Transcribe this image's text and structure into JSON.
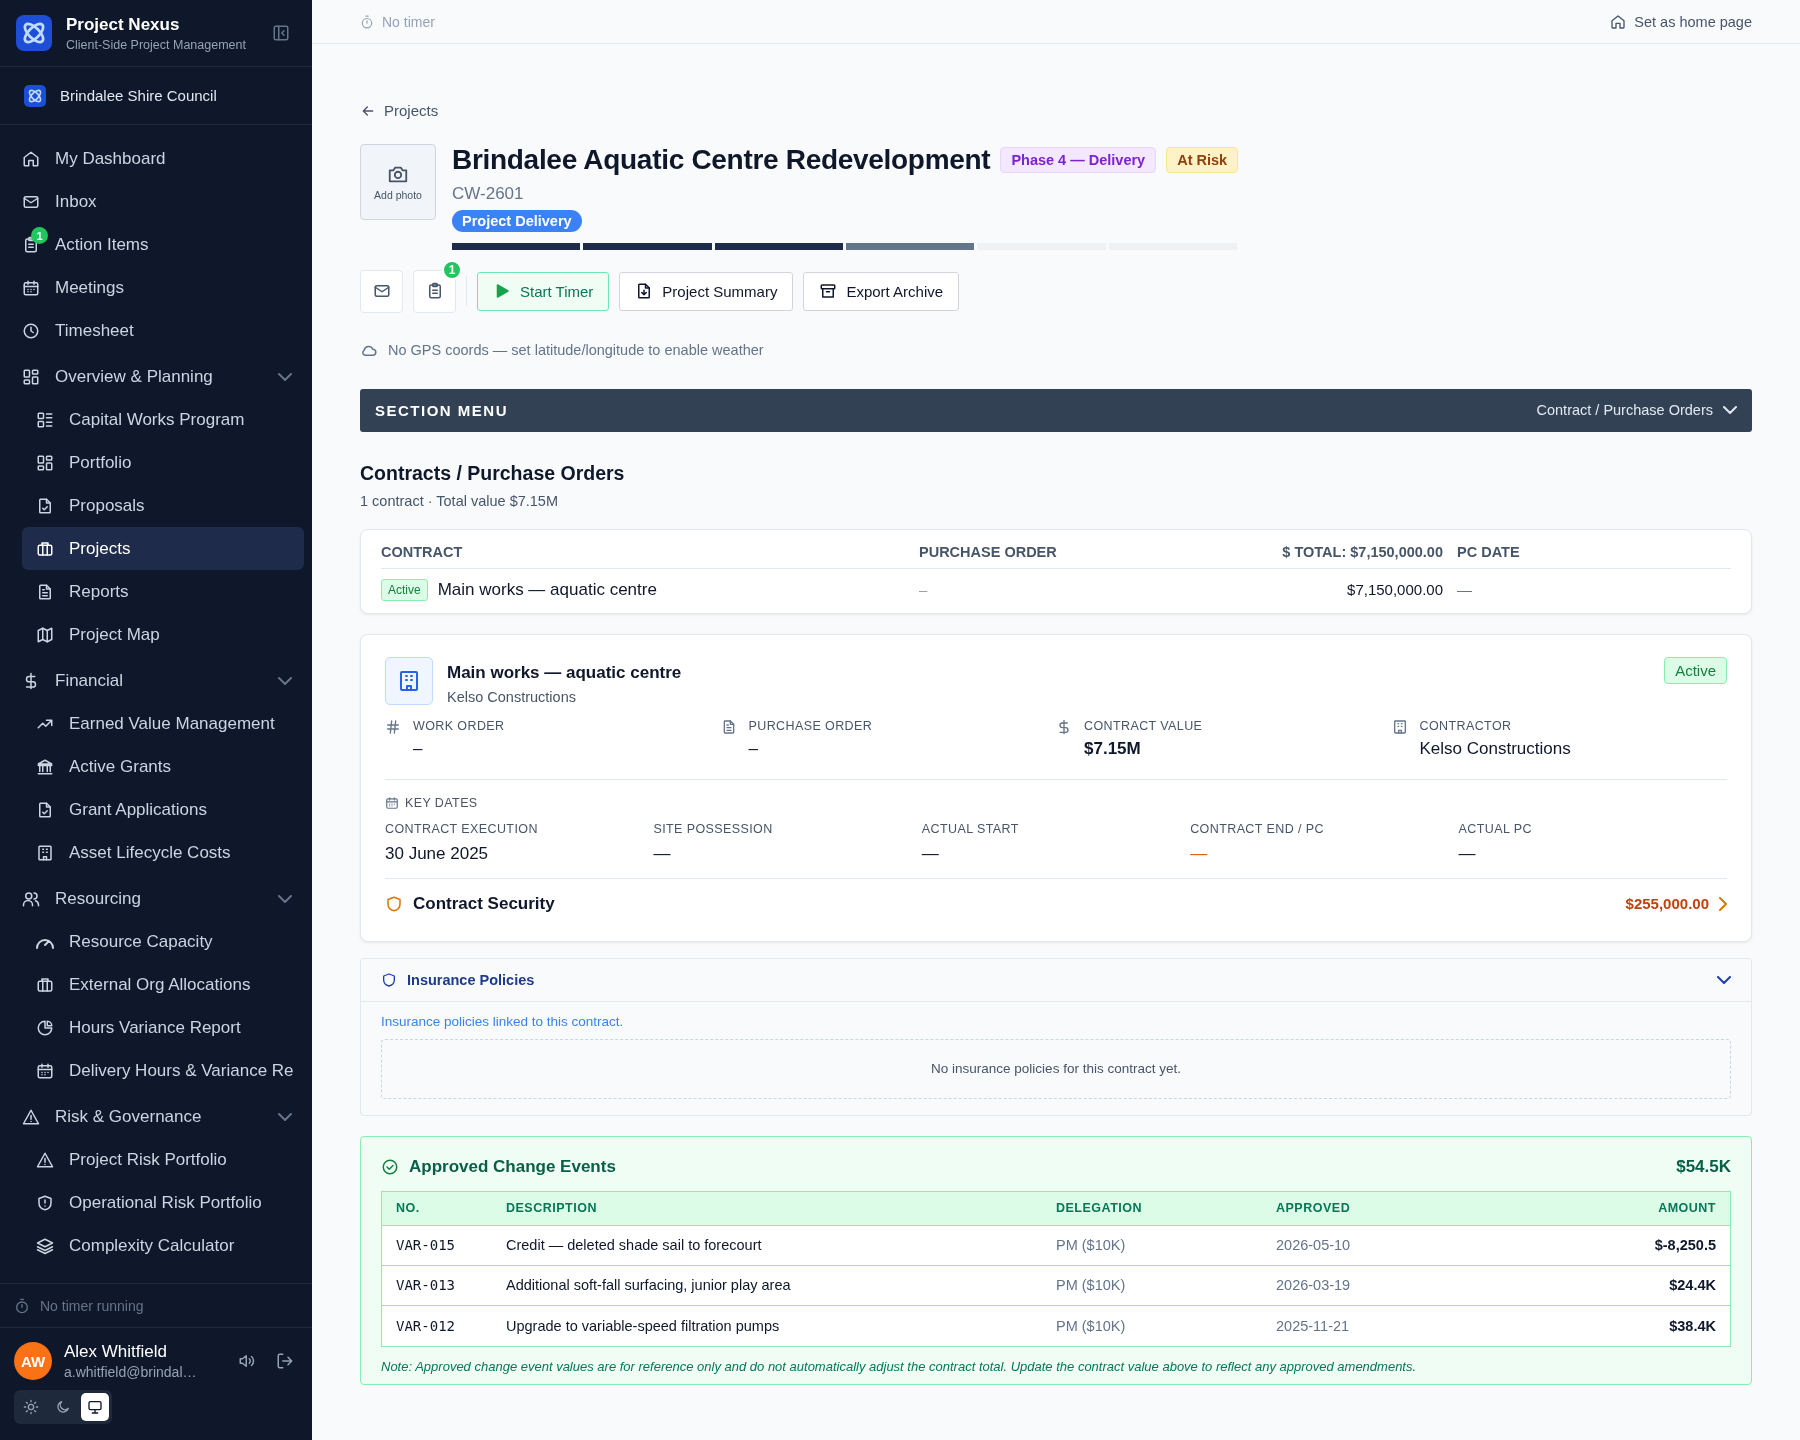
{
  "sidebar": {
    "app_name": "Project Nexus",
    "app_subtitle": "Client-Side Project Management",
    "organization": "Brindalee Shire Council",
    "items": [
      {
        "label": "My Dashboard",
        "selected": false
      },
      {
        "label": "Inbox",
        "selected": false
      },
      {
        "label": "Action Items",
        "selected": false,
        "badge": "1"
      },
      {
        "label": "Meetings",
        "selected": false
      },
      {
        "label": "Timesheet",
        "selected": false
      },
      {
        "label": "Overview & Planning",
        "selected": false,
        "expanded": true,
        "children": [
          {
            "label": "Capital Works Program",
            "selected": false
          },
          {
            "label": "Portfolio",
            "selected": false
          },
          {
            "label": "Proposals",
            "selected": false
          },
          {
            "label": "Projects",
            "selected": true
          },
          {
            "label": "Reports",
            "selected": false
          },
          {
            "label": "Project Map",
            "selected": false
          }
        ]
      },
      {
        "label": "Financial",
        "selected": false,
        "expanded": true,
        "children": [
          {
            "label": "Earned Value Management",
            "selected": false
          },
          {
            "label": "Active Grants",
            "selected": false
          },
          {
            "label": "Grant Applications",
            "selected": false
          },
          {
            "label": "Asset Lifecycle Costs",
            "selected": false
          }
        ]
      },
      {
        "label": "Resourcing",
        "selected": false,
        "expanded": true,
        "children": [
          {
            "label": "Resource Capacity",
            "selected": false
          },
          {
            "label": "External Org Allocations",
            "selected": false
          },
          {
            "label": "Hours Variance Report",
            "selected": false
          },
          {
            "label": "Delivery Hours & Variance Re",
            "selected": false
          }
        ]
      },
      {
        "label": "Risk & Governance",
        "selected": false,
        "expanded": true,
        "children": [
          {
            "label": "Project Risk Portfolio",
            "selected": false
          },
          {
            "label": "Operational Risk Portfolio",
            "selected": false
          },
          {
            "label": "Complexity Calculator",
            "selected": false
          }
        ]
      }
    ],
    "timer_status": "No timer running",
    "user": {
      "initials": "AW",
      "name": "Alex Whitfield",
      "email": "a.whitfield@brindal…"
    },
    "theme_options": [
      {
        "kind": "light",
        "selected": false
      },
      {
        "kind": "dark",
        "selected": false
      },
      {
        "kind": "system",
        "selected": true
      }
    ]
  },
  "top_bar": {
    "timer": "No timer",
    "home_link": "Set as home page"
  },
  "project": {
    "back_link": "Projects",
    "photo_label": "Add photo",
    "title": "Brindalee Aquatic Centre Redevelopment",
    "phase": "Phase 4 — Delivery",
    "risk": "At Risk",
    "code": "CW-2601",
    "stage": "Project Delivery",
    "progress_segments": [
      {
        "complete": true,
        "current": false
      },
      {
        "complete": true,
        "current": false
      },
      {
        "complete": true,
        "current": false
      },
      {
        "complete": false,
        "current": true
      },
      {
        "complete": false,
        "current": false
      },
      {
        "complete": false,
        "current": false
      }
    ],
    "action_badge": "1",
    "buttons": [
      {
        "kind": "timer",
        "label": "Start Timer"
      },
      {
        "kind": "summary",
        "label": "Project Summary"
      },
      {
        "kind": "archive",
        "label": "Export Archive"
      }
    ],
    "weather_note": "No GPS coords — set latitude/longitude to enable weather"
  },
  "section_menu": {
    "title": "SECTION MENU",
    "current": "Contract / Purchase Orders"
  },
  "contracts": {
    "heading": "Contracts / Purchase Orders",
    "summary": "1 contract · Total value $7.15M",
    "columns": [
      "CONTRACT",
      "PURCHASE ORDER",
      "$ TOTAL: **$7,150,000.00**",
      "PC DATE"
    ],
    "rows": [
      {
        "status": "Active",
        "name": "Main works — aquatic centre",
        "purchase_order": "–",
        "total": "$7,150,000.00",
        "pc_date": "—"
      }
    ]
  },
  "contract_card": {
    "name": "Main works — aquatic centre",
    "contractor": "Kelso Constructions",
    "status": "Active",
    "fields": [
      {
        "label": "WORK ORDER",
        "value": "–"
      },
      {
        "label": "PURCHASE ORDER",
        "value": "–"
      },
      {
        "label": "CONTRACT VALUE",
        "value": "$7.15M"
      },
      {
        "label": "CONTRACTOR",
        "value": "Kelso Constructions"
      }
    ],
    "key_dates_title": "KEY DATES",
    "key_dates": [
      {
        "label": "CONTRACT EXECUTION",
        "value": "30 June 2025",
        "flagged": false
      },
      {
        "label": "SITE POSSESSION",
        "value": "—",
        "flagged": false
      },
      {
        "label": "ACTUAL START",
        "value": "—",
        "flagged": false
      },
      {
        "label": "CONTRACT END / PC",
        "value": "—",
        "flagged": true
      },
      {
        "label": "ACTUAL PC",
        "value": "—",
        "flagged": false
      }
    ],
    "security_label": "Contract Security",
    "security_amount": "$255,000.00"
  },
  "insurance": {
    "title": "Insurance Policies",
    "expanded": true,
    "description": "Insurance policies linked to this contract.",
    "empty_message": "No insurance policies for this contract yet."
  },
  "change_events": {
    "title": "Approved Change Events",
    "total": "$54.5K",
    "columns": [
      "NO.",
      "DESCRIPTION",
      "DELEGATION",
      "APPROVED",
      "AMOUNT"
    ],
    "rows": [
      {
        "no": "VAR-015",
        "description": "Credit — deleted shade sail to forecourt",
        "delegation": "PM ($10K)",
        "approved": "2026-05-10",
        "amount": "$-8,250.5"
      },
      {
        "no": "VAR-013",
        "description": "Additional soft-fall surfacing, junior play area",
        "delegation": "PM ($10K)",
        "approved": "2026-03-19",
        "amount": "$24.4K"
      },
      {
        "no": "VAR-012",
        "description": "Upgrade to variable-speed filtration pumps",
        "delegation": "PM ($10K)",
        "approved": "2025-11-21",
        "amount": "$38.4K"
      }
    ],
    "note": "Note: Approved change event values are for reference only and do not automatically adjust the contract total. Update the contract value above to reflect any approved amendments."
  }
}
